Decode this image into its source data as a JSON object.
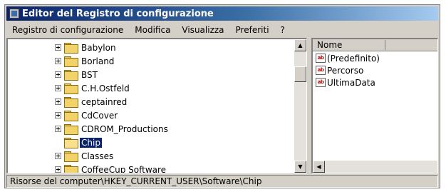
{
  "window": {
    "title": "Editor del Registro di configurazione"
  },
  "menu": {
    "items": [
      "Registro di configurazione",
      "Modifica",
      "Visualizza",
      "Preferiti",
      "?"
    ]
  },
  "tree": {
    "items": [
      {
        "label": "Babylon",
        "expandable": true,
        "selected": false
      },
      {
        "label": "Borland",
        "expandable": true,
        "selected": false
      },
      {
        "label": "BST",
        "expandable": true,
        "selected": false
      },
      {
        "label": "C.H.Ostfeld",
        "expandable": true,
        "selected": false
      },
      {
        "label": "ceptainred",
        "expandable": true,
        "selected": false
      },
      {
        "label": "CdCover",
        "expandable": true,
        "selected": false
      },
      {
        "label": "CDROM_Productions",
        "expandable": true,
        "selected": false
      },
      {
        "label": "Chip",
        "expandable": false,
        "selected": true
      },
      {
        "label": "Classes",
        "expandable": true,
        "selected": false
      },
      {
        "label": "CoffeeCup Software",
        "expandable": true,
        "selected": false
      }
    ]
  },
  "list": {
    "column_header": "Nome",
    "values": [
      {
        "icon": "string-value-icon",
        "icon_text": "ab",
        "label": "(Predefinito)"
      },
      {
        "icon": "string-value-icon",
        "icon_text": "ab",
        "label": "Percorso"
      },
      {
        "icon": "string-value-icon",
        "icon_text": "ab",
        "label": "UltimaData"
      }
    ]
  },
  "status": {
    "path": "Risorse del computer\\HKEY_CURRENT_USER\\Software\\Chip"
  },
  "colors": {
    "title_gradient_start": "#0a246a",
    "selection": "#0a246a",
    "face": "#d4d0c8"
  }
}
